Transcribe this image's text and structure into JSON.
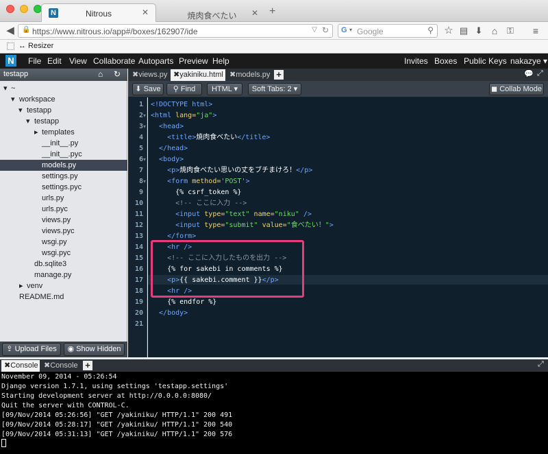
{
  "browser": {
    "tabs": [
      {
        "title": "Nitrous"
      },
      {
        "title": "焼肉食べたい"
      }
    ],
    "url": "https://www.nitrous.io/app#/boxes/162907/ide",
    "search_placeholder": "Google",
    "bookmark": "↔ Resizer"
  },
  "app_menu": {
    "logo": "N",
    "items": [
      "File",
      "Edit",
      "View",
      "Collaborate",
      "Autoparts",
      "Preview",
      "Help"
    ],
    "right": [
      "Invites",
      "Boxes",
      "Public Keys",
      "nakazye ▾"
    ]
  },
  "sidebar": {
    "project": "testapp",
    "tree": [
      "~",
      "workspace",
      "testapp",
      "testapp",
      "templates",
      "__init__.py",
      "__init__.pyc",
      "models.py",
      "settings.py",
      "settings.pyc",
      "urls.py",
      "urls.pyc",
      "views.py",
      "views.pyc",
      "wsgi.py",
      "wsgi.pyc",
      "db.sqlite3",
      "manage.py",
      "venv",
      "README.md"
    ],
    "upload_label": "Upload Files",
    "show_hidden_label": "Show Hidden"
  },
  "editor": {
    "tabs": [
      "views.py",
      "yakiniku.html",
      "models.py"
    ],
    "toolbar": {
      "save": "Save",
      "find": "Find",
      "mode": "HTML",
      "softtabs": "Soft Tabs: 2",
      "collab": "Collab Mode"
    },
    "line_numbers": [
      "1",
      "2",
      "3",
      "4",
      "5",
      "6",
      "7",
      "8",
      "9",
      "10",
      "11",
      "12",
      "13",
      "14",
      "15",
      "16",
      "17",
      "18",
      "19",
      "20",
      "21"
    ],
    "code": {
      "l1": "<!DOCTYPE html>",
      "l2a": "<html ",
      "l2b": "lang=",
      "l2c": "\"ja\"",
      "l2d": ">",
      "l3": "  <head>",
      "l4a": "    <title>",
      "l4b": "焼肉食べたい",
      "l4c": "</title>",
      "l5": "  </head>",
      "l6": "  <body>",
      "l7a": "    <p>",
      "l7b": "焼肉食べたい思いの丈をブチまけろ！",
      "l7c": "</p>",
      "l8a": "    <form ",
      "l8b": "method=",
      "l8c": "'POST'",
      "l8d": ">",
      "l9": "      {% csrf_token %}",
      "l10": "      <!-- ここに入力 -->",
      "l11a": "      <input ",
      "l11b": "type=",
      "l11c": "\"text\" ",
      "l11d": "name=",
      "l11e": "\"niku\" ",
      "l11f": "/>",
      "l12a": "      <input ",
      "l12b": "type=",
      "l12c": "\"submit\" ",
      "l12d": "value=",
      "l12e": "\"食べたい！\"",
      "l12f": ">",
      "l13": "    </form>",
      "l14": "    <hr />",
      "l15": "    <!-- ここに入力したものを出力 -->",
      "l16": "    {% for sakebi in comments %}",
      "l17a": "    <p>",
      "l17b": "{{ sakebi.comment }}",
      "l17c": "</p>",
      "l18": "    <hr />",
      "l19": "    {% endfor %}",
      "l20": "  </body>",
      "l21": ""
    }
  },
  "console": {
    "tabs": [
      "Console",
      "Console"
    ],
    "lines": [
      "November 09, 2014 - 05:26:54",
      "Django version 1.7.1, using settings 'testapp.settings'",
      "Starting development server at http://0.0.0.0:8080/",
      "Quit the server with CONTROL-C.",
      "[09/Nov/2014 05:26:56] \"GET /yakiniku/ HTTP/1.1\" 200 491",
      "[09/Nov/2014 05:28:17] \"GET /yakiniku/ HTTP/1.1\" 200 540",
      "[09/Nov/2014 05:31:13] \"GET /yakiniku/ HTTP/1.1\" 200 576"
    ]
  }
}
